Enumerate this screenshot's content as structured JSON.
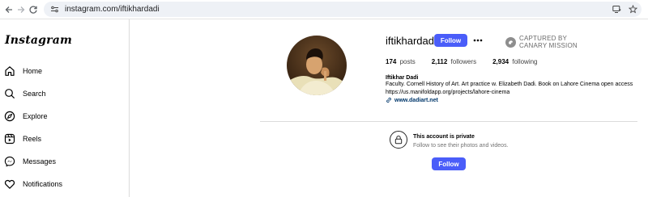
{
  "browser": {
    "url": "instagram.com/iftikhardadi"
  },
  "sidebar": {
    "logo": "Instagram",
    "items": [
      {
        "label": "Home",
        "icon": "home-icon"
      },
      {
        "label": "Search",
        "icon": "search-icon"
      },
      {
        "label": "Explore",
        "icon": "compass-icon"
      },
      {
        "label": "Reels",
        "icon": "reels-icon"
      },
      {
        "label": "Messages",
        "icon": "messenger-icon"
      },
      {
        "label": "Notifications",
        "icon": "heart-icon"
      }
    ]
  },
  "profile": {
    "username": "iftikhardadi",
    "follow_label": "Follow",
    "watermark_line1": "CAPTURED BY",
    "watermark_line2": "CANARY MISSION",
    "posts_count": "174",
    "posts_label": "posts",
    "followers_count": "2,112",
    "followers_label": "followers",
    "following_count": "2,934",
    "following_label": "following",
    "full_name": "Iftikhar Dadi",
    "bio": "Faculty. Cornell History of Art. Art practice w. Elizabeth Dadi. Book on Lahore Cinema open access",
    "bio_url": "https://us.manifoldapp.org/projects/lahore-cinema",
    "external_link": "www.dadiart.net"
  },
  "private_notice": {
    "title": "This account is private",
    "subtitle": "Follow to see their photos and videos.",
    "follow_label": "Follow"
  },
  "colors": {
    "accent": "#4a5df9",
    "link": "#00376b",
    "border": "#dbdbdb"
  }
}
